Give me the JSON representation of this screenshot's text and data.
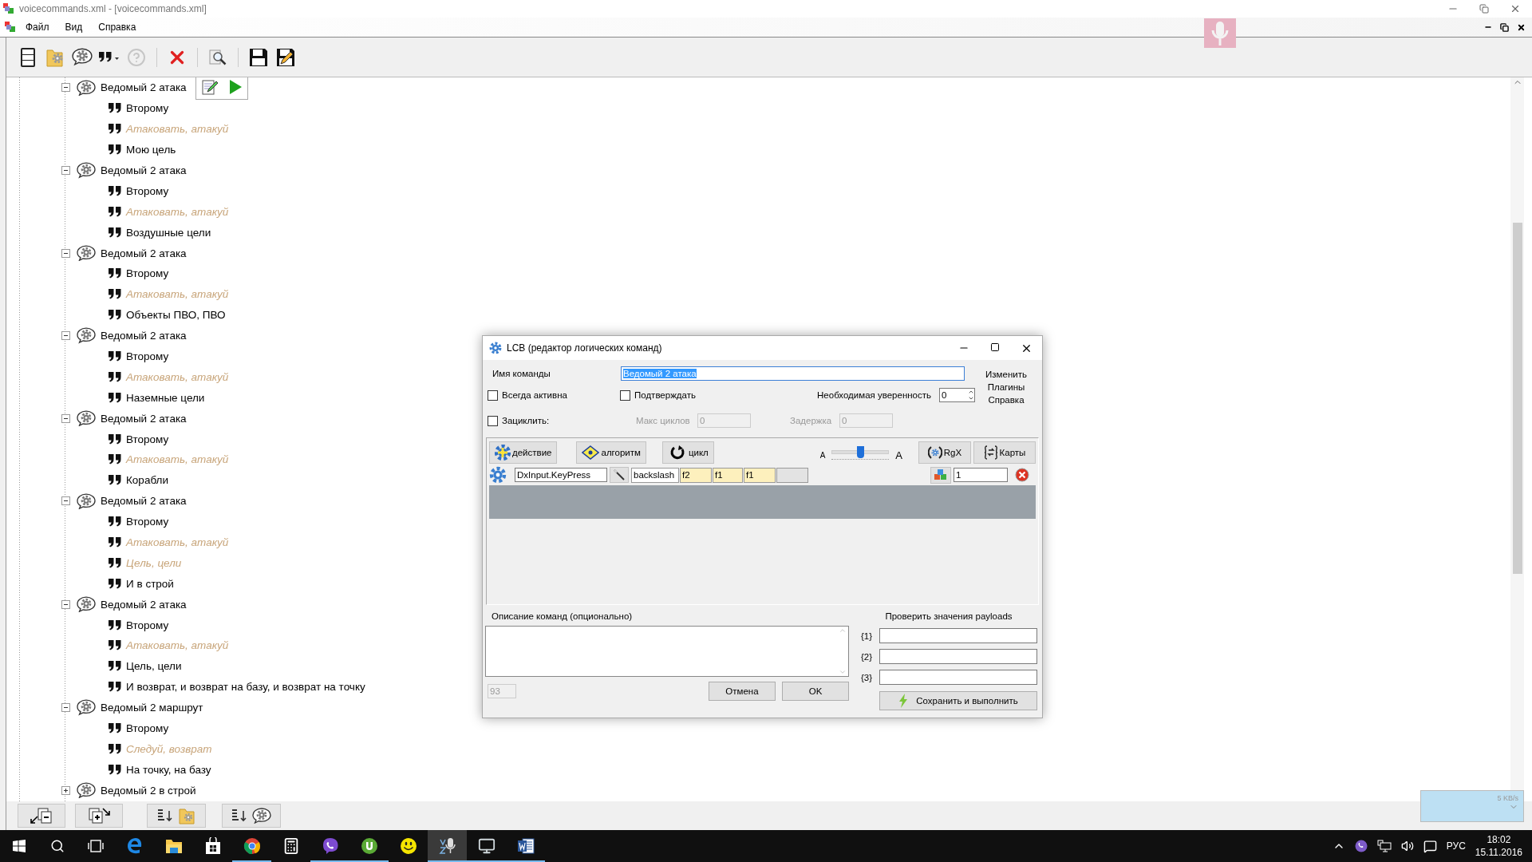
{
  "window": {
    "title": "voicecommands.xml - [voicecommands.xml]"
  },
  "menu": [
    "Файл",
    "Вид",
    "Справка"
  ],
  "toolbar": [
    {
      "kind": "cabinet",
      "disabled": false
    },
    {
      "kind": "folder_gear",
      "disabled": false
    },
    {
      "kind": "bubble_gear",
      "disabled": false
    },
    {
      "kind": "quote_menu",
      "disabled": false
    },
    {
      "kind": "help",
      "disabled": true
    },
    {
      "kind": "delete",
      "disabled": false
    },
    {
      "kind": "find",
      "disabled": false
    },
    {
      "kind": "save",
      "disabled": false
    },
    {
      "kind": "save_as",
      "disabled": false
    }
  ],
  "tree": [
    {
      "label": "Ведомый 2 атака",
      "expanded": true,
      "children": [
        {
          "label": "Второму",
          "kind": "phrase"
        },
        {
          "label": "Атаковать, атакуй",
          "kind": "optional"
        },
        {
          "label": "Мою цель",
          "kind": "phrase"
        }
      ]
    },
    {
      "label": "Ведомый 2 атака",
      "expanded": true,
      "children": [
        {
          "label": "Второму",
          "kind": "phrase"
        },
        {
          "label": "Атаковать, атакуй",
          "kind": "optional"
        },
        {
          "label": "Воздушные цели",
          "kind": "phrase"
        }
      ]
    },
    {
      "label": "Ведомый 2 атака",
      "expanded": true,
      "children": [
        {
          "label": "Второму",
          "kind": "phrase"
        },
        {
          "label": "Атаковать, атакуй",
          "kind": "optional"
        },
        {
          "label": "Объекты ПВО, ПВО",
          "kind": "phrase"
        }
      ]
    },
    {
      "label": "Ведомый 2 атака",
      "expanded": true,
      "children": [
        {
          "label": "Второму",
          "kind": "phrase"
        },
        {
          "label": "Атаковать, атакуй",
          "kind": "optional"
        },
        {
          "label": "Наземные цели",
          "kind": "phrase"
        }
      ]
    },
    {
      "label": "Ведомый 2 атака",
      "expanded": true,
      "children": [
        {
          "label": "Второму",
          "kind": "phrase"
        },
        {
          "label": "Атаковать, атакуй",
          "kind": "optional"
        },
        {
          "label": "Корабли",
          "kind": "phrase"
        }
      ]
    },
    {
      "label": "Ведомый 2 атака",
      "expanded": true,
      "children": [
        {
          "label": "Второму",
          "kind": "phrase"
        },
        {
          "label": "Атаковать, атакуй",
          "kind": "optional"
        },
        {
          "label": "Цель, цели",
          "kind": "optional"
        },
        {
          "label": "И в строй",
          "kind": "phrase"
        }
      ]
    },
    {
      "label": "Ведомый 2 атака",
      "expanded": true,
      "children": [
        {
          "label": "Второму",
          "kind": "phrase"
        },
        {
          "label": "Атаковать, атакуй",
          "kind": "optional"
        },
        {
          "label": "Цель, цели",
          "kind": "phrase"
        },
        {
          "label": "И возврат, и возврат на базу, и возврат на точку",
          "kind": "phrase"
        }
      ]
    },
    {
      "label": "Ведомый 2 маршрут",
      "expanded": true,
      "children": [
        {
          "label": "Второму",
          "kind": "phrase"
        },
        {
          "label": "Следуй, возврат",
          "kind": "optional"
        },
        {
          "label": "На точку, на базу",
          "kind": "phrase"
        }
      ]
    },
    {
      "label": "Ведомый 2 в строй",
      "expanded": false
    }
  ],
  "dialog": {
    "title": "LCB (редактор логических команд)",
    "name_label": "Имя команды",
    "name_value": "Ведомый 2 атака",
    "name_highlighted": true,
    "links": [
      "Изменить",
      "Плагины",
      "Справка"
    ],
    "always_active": {
      "label": "Всегда активна",
      "checked": false
    },
    "confirm": {
      "label": "Подтверждать",
      "checked": false
    },
    "confidence": {
      "label": "Необходимая уверенность",
      "value": "0"
    },
    "loop": {
      "label": "Зациклить:",
      "checked": false
    },
    "max_cycles": {
      "label": "Макс циклов",
      "value": "0",
      "disabled": true
    },
    "delay": {
      "label": "Задержка",
      "value": "0",
      "disabled": true
    },
    "tools": [
      "действие",
      "алгоритм",
      "цикл"
    ],
    "font_slider": {
      "small": "A",
      "large": "A",
      "level": 0.5
    },
    "tools_right": [
      "RgX",
      "Карты"
    ],
    "action": {
      "name": "DxInput.KeyPress",
      "key": "backslash",
      "params": [
        "f2",
        "f1",
        "f1"
      ],
      "repeat": "1"
    },
    "description_label": "Описание команд (опционально)",
    "counter": "93",
    "cancel": "Отмена",
    "ok": "OK",
    "payloads_label": "Проверить значения payloads",
    "payloads": [
      "{1}",
      "{2}",
      "{3}"
    ],
    "save_run": "Сохранить и выполнить"
  },
  "speed_widget": {
    "reading": "5 KB/s"
  },
  "taskbar": {
    "apps": [
      {
        "kind": "start",
        "running": false,
        "active": false
      },
      {
        "kind": "search",
        "running": false,
        "active": false
      },
      {
        "kind": "taskview",
        "running": false,
        "active": false
      },
      {
        "kind": "browser_e",
        "running": false,
        "active": false
      },
      {
        "kind": "folder",
        "running": false,
        "active": false
      },
      {
        "kind": "store",
        "running": false,
        "active": false
      },
      {
        "kind": "browser_round",
        "running": true,
        "active": false
      },
      {
        "kind": "calculator",
        "running": false,
        "active": false
      },
      {
        "kind": "phone",
        "running": true,
        "active": false
      },
      {
        "kind": "torrent",
        "running": true,
        "active": false
      },
      {
        "kind": "smiley",
        "running": false,
        "active": false
      },
      {
        "kind": "microphone",
        "running": true,
        "active": true
      },
      {
        "kind": "monitor",
        "running": true,
        "active": false
      },
      {
        "kind": "document",
        "running": true,
        "active": false
      }
    ],
    "language": "РУС",
    "time": "18:02",
    "date": "15.11.2016"
  }
}
